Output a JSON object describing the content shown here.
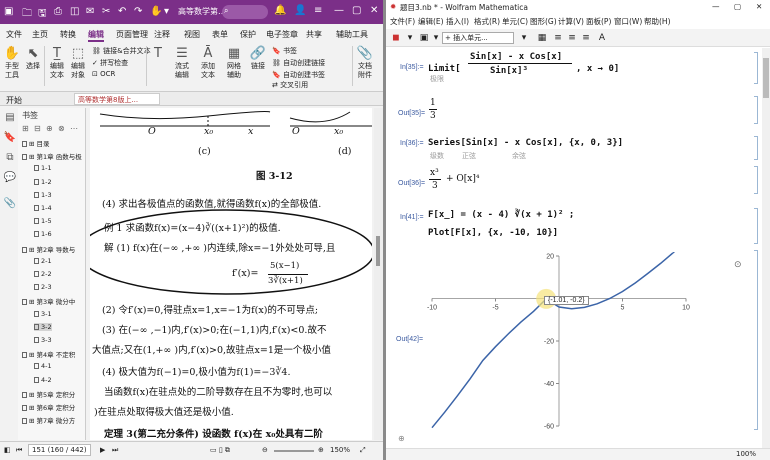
{
  "pdf": {
    "window_title": "高等数学第…",
    "search_placeholder": "",
    "menu": [
      "文件",
      "主页",
      "转换",
      "编辑",
      "页面管理",
      "注释",
      "视图",
      "表单",
      "保护",
      "电子签章",
      "共享",
      "辅助工具"
    ],
    "active_menu": "编辑",
    "ribbon": {
      "hand": "手型\n工具",
      "select": "选择",
      "edit_text": "编辑\n文本",
      "edit_obj": "编辑\n对象",
      "link_merge": "链接&合并文本",
      "spell": "拼写检查",
      "ocr": "OCR",
      "flow_text": "流式\n编辑",
      "add_text": "添加\n文本",
      "grid": "网格\n辅助",
      "link": "链接",
      "bookmark": "书签",
      "autolink": "自动创建链接",
      "auto_bookmark": "自动创建书签",
      "crossref": "交叉引用",
      "file_attach": "文档\n附件",
      "image": "图"
    },
    "tab_start": "开始",
    "doc_tab": "高等数学第8版上...",
    "bookmarks_title": "书签",
    "bookmarks": [
      {
        "label": "目录",
        "level": 0
      },
      {
        "label": "第1章 函数与极",
        "level": 0
      },
      {
        "label": "1-1",
        "level": 1
      },
      {
        "label": "1-2",
        "level": 1
      },
      {
        "label": "1-3",
        "level": 1
      },
      {
        "label": "1-4",
        "level": 1
      },
      {
        "label": "1-5",
        "level": 1
      },
      {
        "label": "1-6",
        "level": 1
      },
      {
        "label": "第2章 导数与",
        "level": 0
      },
      {
        "label": "2-1",
        "level": 1
      },
      {
        "label": "2-2",
        "level": 1
      },
      {
        "label": "2-3",
        "level": 1
      },
      {
        "label": "第3章 微分中",
        "level": 0
      },
      {
        "label": "3-1",
        "level": 1
      },
      {
        "label": "3-2",
        "level": 1,
        "selected": true
      },
      {
        "label": "3-3",
        "level": 1
      },
      {
        "label": "第4章 不定积",
        "level": 0
      },
      {
        "label": "4-1",
        "level": 1
      },
      {
        "label": "4-2",
        "level": 1
      },
      {
        "label": "第5章 定积分",
        "level": 0
      },
      {
        "label": "第6章 定积分",
        "level": 0
      },
      {
        "label": "第7章 微分方",
        "level": 0
      }
    ],
    "page": {
      "fig_c": "(c)",
      "fig_d": "(d)",
      "fig_caption": "图 3-12",
      "axis_O": "O",
      "axis_x0": "x₀",
      "axis_x": "x",
      "axis_O2": "O",
      "axis_x02": "x₀",
      "line1": "(4) 求出各极值点的函数值,就得函数f(x)的全部极值.",
      "ex_title": "例 1   求函数f(x)=(x−4)∛((x+1)²)的极值.",
      "sol1": "解   (1) f(x)在(−∞ ,+∞ )内连续,除x=−1外处处可导,且",
      "deriv": "f′(x)=",
      "deriv_num": "5(x−1)",
      "deriv_den": "3∛(x+1)",
      "step2": "(2) 令f′(x)=0,得驻点x=1,x=−1为f(x)的不可导点;",
      "step3": "(3) 在(−∞ ,−1)内,f′(x)>0;在(−1,1)内,f′(x)<0.故不",
      "step3b": "大值点;又在(1,+∞ )内,f′(x)>0,故驻点x=1是一个极小值",
      "step4": "(4) 极大值为f(−1)=0,极小值为f(1)=−3∛4.",
      "note1": "当函数f(x)在驻点处的二阶导数存在且不为零时,也可以",
      "note2": ")在驻点处取得极大值还是极小值.",
      "theorem": "定理 3(第二充分条件)   设函数 f(x)在 x₀处具有二阶"
    },
    "status": {
      "page": "151 (160 / 442)",
      "zoom": "150%"
    }
  },
  "mma": {
    "title": "题目3.nb * - Wolfram Mathematica",
    "menu": [
      "文件(F)",
      "编辑(E)",
      "插入(I)",
      "格式(R)",
      "单元(C)",
      "图形(G)",
      "计算(V)",
      "面板(P)",
      "窗口(W)",
      "帮助(H)"
    ],
    "insert_dropdown": "+ 插入单元...",
    "cells": [
      {
        "in_label": "In[35]:=",
        "code": "Limit[ (Sin[x] − x Cos[x]) / Sin[x]³ , x → 0]",
        "hint": "极限"
      },
      {
        "out_label": "Out[35]=",
        "result": "1/3"
      },
      {
        "in_label": "In[36]:=",
        "code": "Series[Sin[x] − x Cos[x], {x, 0, 3}]",
        "hints": [
          "级数",
          "正弦",
          "余弦"
        ]
      },
      {
        "out_label": "Out[36]=",
        "result": "x³/3 + O[x]⁴"
      },
      {
        "in_label": "In[41]:=",
        "code1": "F[x_] = (x − 4) ∛((x + 1)²);",
        "code2": "Plot[F[x], {x, −10, 10}]"
      },
      {
        "out_label": "Out[42]="
      }
    ],
    "tooltip": "{-1.01, -0.2}",
    "status_zoom": "100%"
  },
  "chart_data": {
    "type": "line",
    "title": "",
    "xlabel": "",
    "ylabel": "",
    "xlim": [
      -10,
      10
    ],
    "ylim": [
      -60,
      20
    ],
    "xticks": [
      -10,
      -5,
      5,
      10
    ],
    "yticks": [
      20,
      -20,
      -40,
      -60
    ],
    "series": [
      {
        "x": [
          -10,
          -9,
          -8,
          -7,
          -6,
          -5,
          -4,
          -3,
          -2,
          -1.01,
          0,
          1,
          2,
          3,
          4,
          5,
          6,
          7,
          8,
          9,
          10
        ],
        "y": [
          -60.8,
          -53.5,
          -45.8,
          -37.8,
          -29.2,
          -22.7,
          -16.7,
          -11.1,
          -6.0,
          -0.2,
          -4.0,
          -4.8,
          -4.2,
          -2.5,
          0,
          3.3,
          7.3,
          11.8,
          16.5,
          21.6,
          27.1
        ]
      }
    ]
  }
}
